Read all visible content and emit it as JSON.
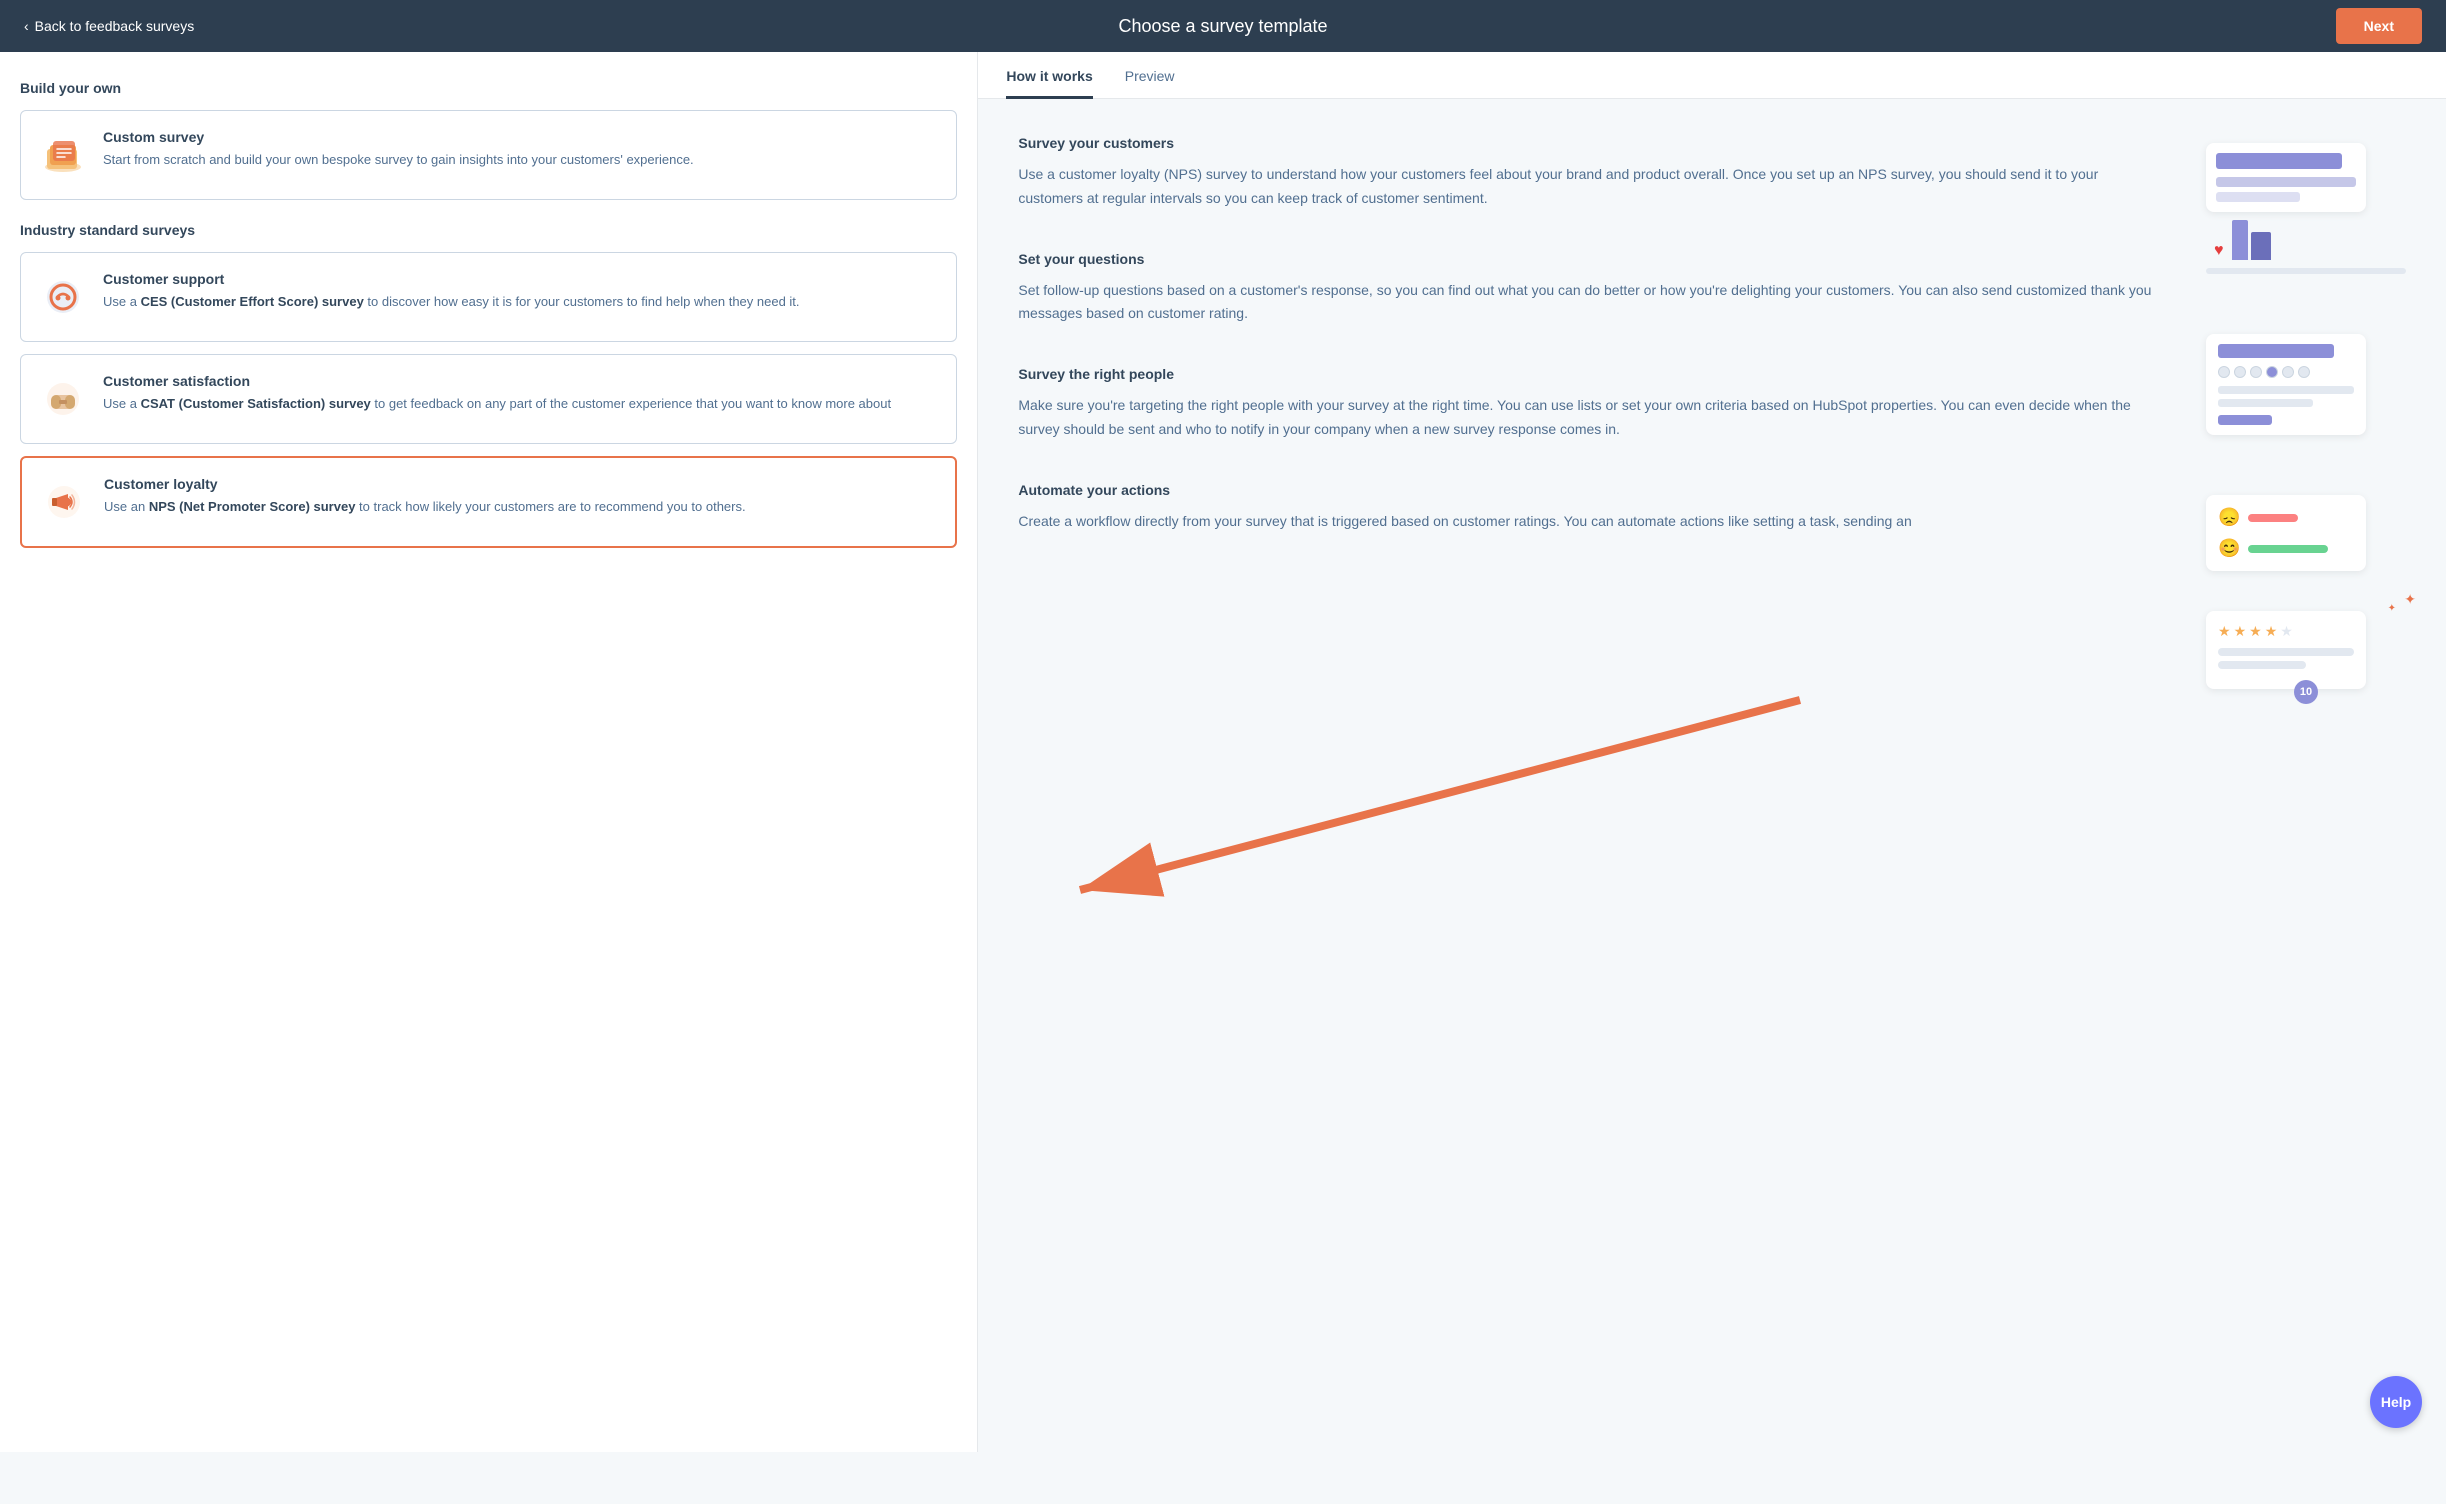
{
  "header": {
    "back_label": "Back to feedback surveys",
    "title": "Choose a survey template",
    "next_label": "Next"
  },
  "left_panel": {
    "build_own_label": "Build your own",
    "custom_survey": {
      "title": "Custom survey",
      "desc": "Start from scratch and build your own bespoke survey to gain insights into your customers' experience."
    },
    "industry_label": "Industry standard surveys",
    "customer_support": {
      "title": "Customer support",
      "desc_prefix": "Use a ",
      "desc_bold": "CES (Customer Effort Score) survey",
      "desc_suffix": " to discover how easy it is for your customers to find help when they need it."
    },
    "customer_satisfaction": {
      "title": "Customer satisfaction",
      "desc_prefix": "Use a ",
      "desc_bold": "CSAT (Customer Satisfaction) survey",
      "desc_suffix": " to get feedback on any part of the customer experience that you want to know more about"
    },
    "customer_loyalty": {
      "title": "Customer loyalty",
      "desc_prefix": "Use an ",
      "desc_bold": "NPS (Net Promoter Score) survey",
      "desc_suffix": " to track how likely your customers are to recommend you to others."
    }
  },
  "right_panel": {
    "tabs": [
      {
        "label": "How it works",
        "active": true
      },
      {
        "label": "Preview",
        "active": false
      }
    ],
    "sections": [
      {
        "title": "Survey your customers",
        "body": "Use a customer loyalty (NPS) survey to understand how your customers feel about your brand and product overall. Once you set up an NPS survey, you should send it to your customers at regular intervals so you can keep track of customer sentiment."
      },
      {
        "title": "Set your questions",
        "body": "Set follow-up questions based on a customer's response, so you can find out what you can do better or how you're delighting your customers. You can also send customized thank you messages based on customer rating."
      },
      {
        "title": "Survey the right people",
        "body": "Make sure you're targeting the right people with your survey at the right time. You can use lists or set your own criteria based on HubSpot properties. You can even decide when the survey should be sent and who to notify in your company when a new survey response comes in."
      },
      {
        "title": "Automate your actions",
        "body": "Create a workflow directly from your survey that is triggered based on customer ratings. You can automate actions like setting a task, sending an"
      }
    ]
  },
  "help_label": "Help"
}
